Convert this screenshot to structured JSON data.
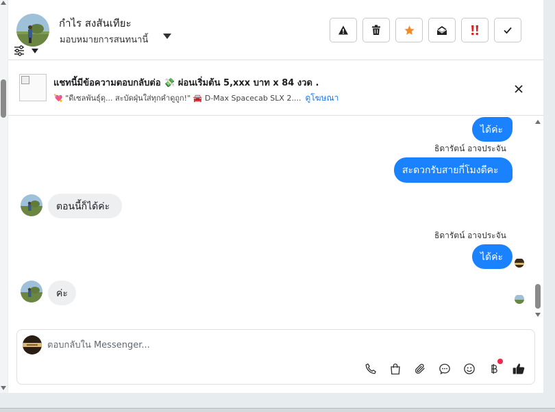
{
  "header": {
    "name": "กำไร สงสันเทียะ",
    "assign_label": "มอบหมายการสนทนานี้"
  },
  "actions": [
    {
      "name": "report-spam-button",
      "icon": "warning-icon"
    },
    {
      "name": "delete-button",
      "icon": "trash-icon"
    },
    {
      "name": "star-button",
      "icon": "star-icon"
    },
    {
      "name": "mark-unread-button",
      "icon": "envelope-open-icon"
    },
    {
      "name": "mark-important-button",
      "icon": "exclamation-icon"
    },
    {
      "name": "mark-done-button",
      "icon": "check-icon"
    }
  ],
  "ad": {
    "title": "แชทนี้มีข้อความตอบกลับต่อ 💸 ผ่อนเริ่มต้น 5,xxx บาท x 84 งวด .",
    "subtitle": "💘 \"ดีเซลพันธุ์ดุ... สะบัดฝุ่นใส่ทุกคำดูถูก!\" 🚘 D-Max Spacecab SLX 2....",
    "link": "ดูโฆษณา"
  },
  "messages": {
    "m1": "ได้ค่ะ",
    "sender1": "ธิดารัตน์ อาจประจัน",
    "m2": "สะดวกรับสายกี่โมงดีคะ",
    "m3": "ตอนนี้ก็ได้ค่ะ",
    "sender2": "ธิดารัตน์ อาจประจัน",
    "m4": "ได้ค่ะ",
    "m5": "ค่ะ"
  },
  "composer": {
    "placeholder": "ตอบกลับใน Messenger..."
  },
  "colors": {
    "outgoing_bubble": "#1a82ff",
    "incoming_bubble": "#eeeff1",
    "star": "#f0892a",
    "important": "#e02020"
  }
}
